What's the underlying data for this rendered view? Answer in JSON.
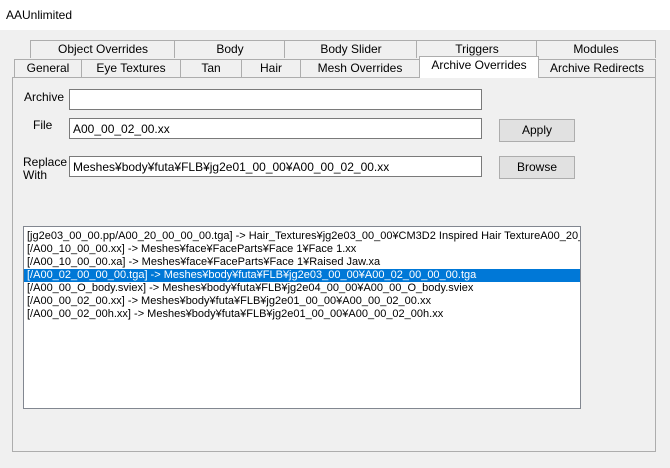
{
  "window": {
    "title": "AAUnlimited"
  },
  "tabs": {
    "row1": [
      "Object Overrides",
      "Body",
      "Body Slider",
      "Triggers",
      "Modules"
    ],
    "row2": [
      "General",
      "Eye Textures",
      "Tan",
      "Hair",
      "Mesh Overrides",
      "Archive Overrides",
      "Archive Redirects"
    ],
    "active": "Archive Overrides"
  },
  "form": {
    "archive_label": "Archive",
    "archive_value": "",
    "file_label": "File",
    "file_value": "A00_00_02_00.xx",
    "replace_label_line1": "Replace",
    "replace_label_line2": "With",
    "replace_value": "Meshes¥body¥futa¥FLB¥jg2e01_00_00¥A00_00_02_00.xx",
    "apply_label": "Apply",
    "browse_label": "Browse"
  },
  "overrides_list": {
    "items": [
      "[jg2e03_00_00.pp/A00_20_00_00_00.tga] -> Hair_Textures¥jg2e03_00_00¥CM3D2 Inspired Hair TextureA00_20_",
      "[/A00_10_00_00.xx] -> Meshes¥face¥FaceParts¥Face 1¥Face 1.xx",
      "[/A00_10_00_00.xa] -> Meshes¥face¥FaceParts¥Face 1¥Raised Jaw.xa",
      "[/A00_02_00_00_00.tga] -> Meshes¥body¥futa¥FLB¥jg2e03_00_00¥A00_02_00_00_00.tga",
      "[/A00_00_O_body.sviex] -> Meshes¥body¥futa¥FLB¥jg2e04_00_00¥A00_00_O_body.sviex",
      "[/A00_00_02_00.xx] -> Meshes¥body¥futa¥FLB¥jg2e01_00_00¥A00_00_02_00.xx",
      "[/A00_00_02_00h.xx] -> Meshes¥body¥futa¥FLB¥jg2e01_00_00¥A00_00_02_00h.xx"
    ],
    "selected_index": 3
  }
}
